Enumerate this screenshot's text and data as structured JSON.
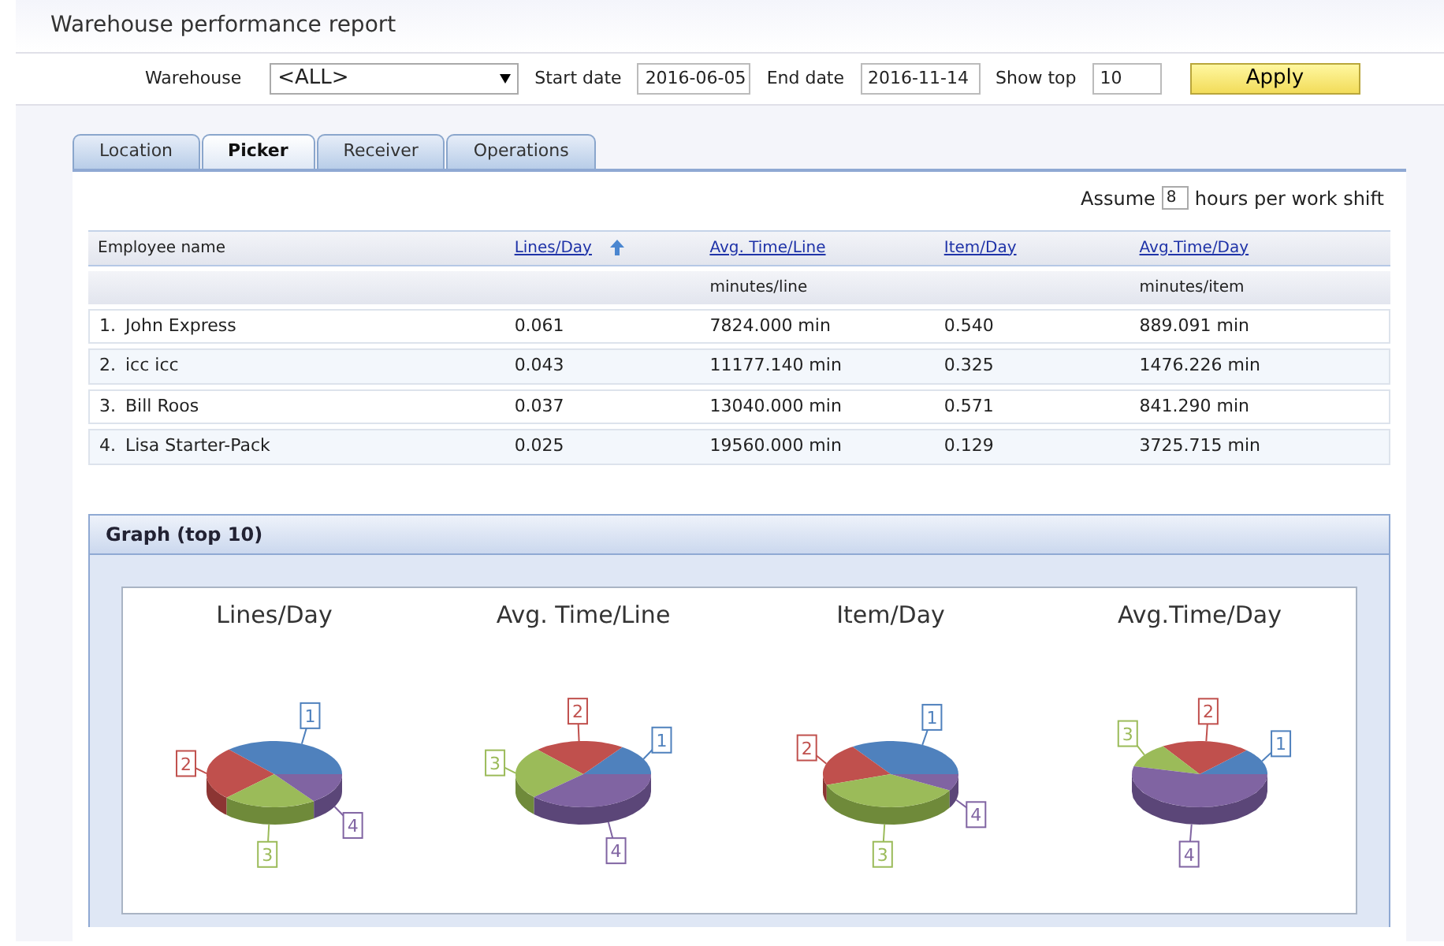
{
  "window": {
    "title": "Warehouse performance report"
  },
  "filters": {
    "warehouse": {
      "label": "Warehouse",
      "value": "<ALL>"
    },
    "start_date": {
      "label": "Start date",
      "value": "2016-06-05"
    },
    "end_date": {
      "label": "End date",
      "value": "2016-11-14"
    },
    "show_top": {
      "label": "Show top",
      "value": "10"
    },
    "apply": "Apply"
  },
  "tabs": [
    {
      "label": "Location",
      "selected": false
    },
    {
      "label": "Picker",
      "selected": true
    },
    {
      "label": "Receiver",
      "selected": false
    },
    {
      "label": "Operations",
      "selected": false
    }
  ],
  "assume": {
    "prefix": "Assume",
    "value": "8",
    "suffix": "hours per work shift"
  },
  "table": {
    "columns": [
      {
        "label": "Employee name",
        "kind": "plain",
        "sorted": false
      },
      {
        "label": "Lines/Day",
        "kind": "link",
        "sorted": true
      },
      {
        "label": "Avg. Time/Line",
        "kind": "link",
        "sorted": false,
        "unit": "minutes/line"
      },
      {
        "label": "Item/Day",
        "kind": "link",
        "sorted": false
      },
      {
        "label": "Avg.Time/Day",
        "kind": "link",
        "sorted": false,
        "unit": "minutes/item"
      }
    ],
    "rows": [
      {
        "rank": "1.",
        "cells": [
          "John Express",
          "0.061",
          "7824.000 min",
          "0.540",
          "889.091 min"
        ]
      },
      {
        "rank": "2.",
        "cells": [
          "icc icc",
          "0.043",
          "11177.140 min",
          "0.325",
          "1476.226 min"
        ]
      },
      {
        "rank": "3.",
        "cells": [
          "Bill Roos",
          "0.037",
          "13040.000 min",
          "0.571",
          "841.290 min"
        ]
      },
      {
        "rank": "4.",
        "cells": [
          "Lisa Starter-Pack",
          "0.025",
          "19560.000 min",
          "0.129",
          "3725.715 min"
        ]
      }
    ]
  },
  "graph": {
    "title": "Graph (top 10)",
    "charts": [
      {
        "title": "Lines/Day",
        "slice_labels": [
          "1",
          "2",
          "3",
          "4"
        ]
      },
      {
        "title": "Avg. Time/Line",
        "slice_labels": [
          "1",
          "2",
          "3",
          "4"
        ]
      },
      {
        "title": "Item/Day",
        "slice_labels": [
          "1",
          "2",
          "3",
          "4"
        ]
      },
      {
        "title": "Avg.Time/Day",
        "slice_labels": [
          "1",
          "2",
          "3",
          "4"
        ]
      }
    ]
  }
}
